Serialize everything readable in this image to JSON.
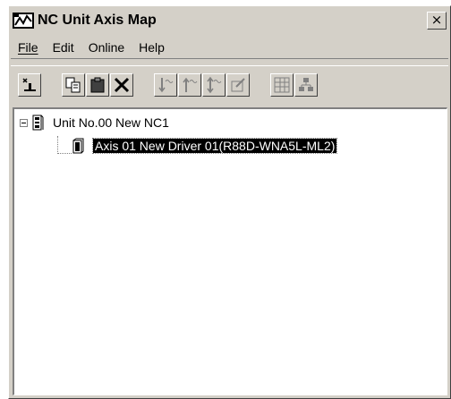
{
  "window": {
    "title": "NC Unit Axis Map",
    "close_glyph": "×"
  },
  "menu": {
    "items": [
      {
        "label": "File"
      },
      {
        "label": "Edit"
      },
      {
        "label": "Online"
      },
      {
        "label": "Help"
      }
    ]
  },
  "toolbar": {
    "buttons": [
      {
        "icon": "new-unit-icon",
        "enabled": true
      },
      {
        "icon": "copy-icon",
        "enabled": true
      },
      {
        "icon": "paste-icon",
        "enabled": true
      },
      {
        "icon": "delete-icon",
        "enabled": true
      },
      {
        "icon": "download-icon",
        "enabled": false
      },
      {
        "icon": "upload-icon",
        "enabled": false
      },
      {
        "icon": "compare-icon",
        "enabled": false
      },
      {
        "icon": "edit-parameters-icon",
        "enabled": false
      },
      {
        "icon": "monitor-icon",
        "enabled": false
      },
      {
        "icon": "network-icon",
        "enabled": false
      }
    ]
  },
  "tree": {
    "root": {
      "label": "Unit No.00 New NC1",
      "expanded": true,
      "icon": "nc-unit-icon"
    },
    "children": [
      {
        "label": "Axis 01 New Driver 01(R88D-WNA5L-ML2)",
        "selected": true,
        "icon": "driver-icon"
      }
    ]
  },
  "colors": {
    "face": "#d4d0c8",
    "selection_bg": "#000000",
    "selection_fg": "#ffffff"
  }
}
